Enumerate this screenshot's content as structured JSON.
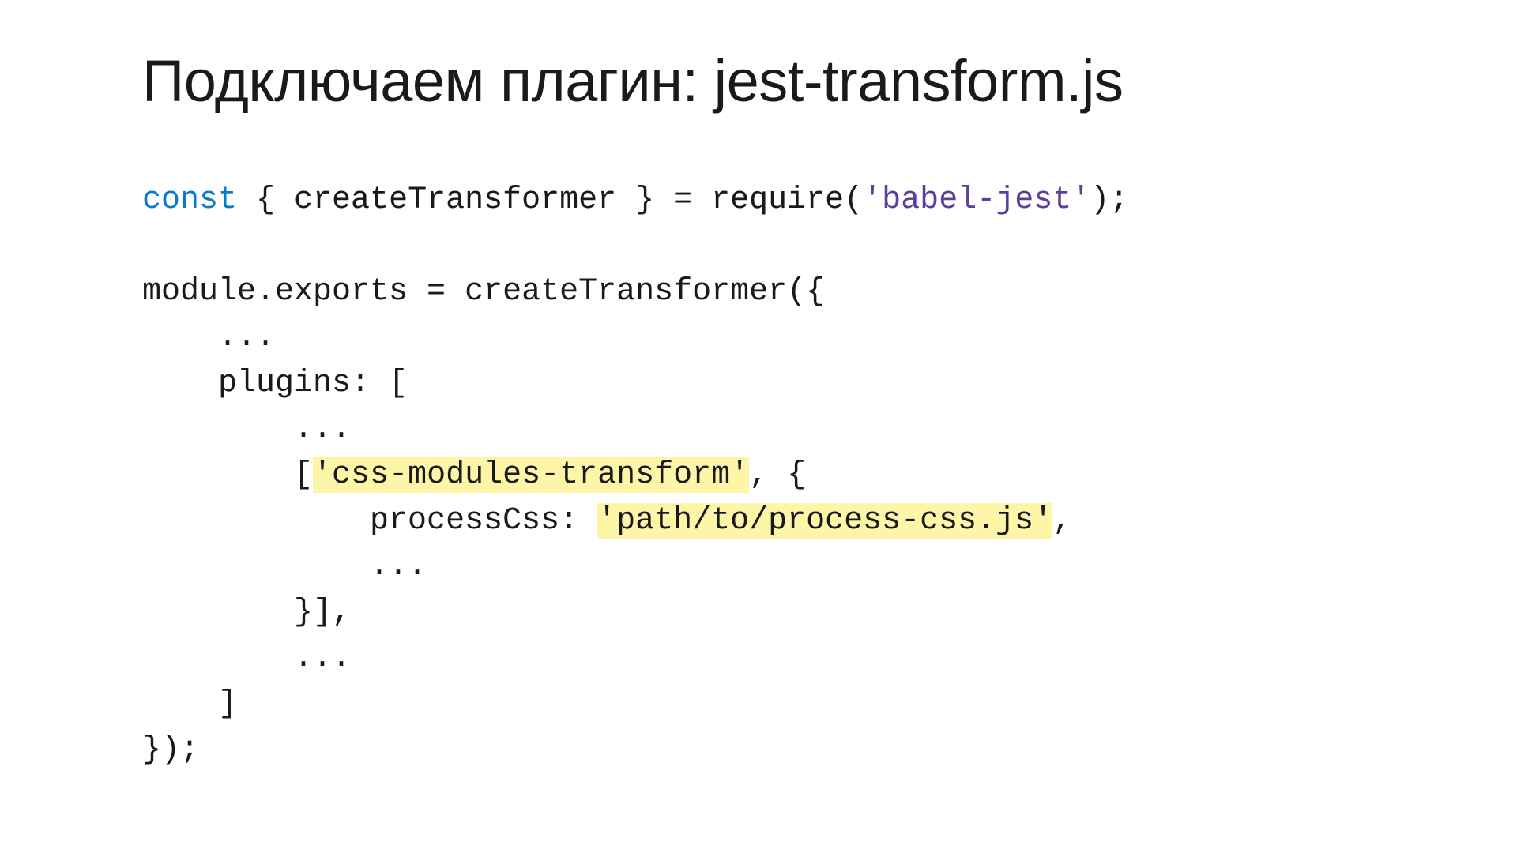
{
  "title": "Подключаем плагин: jest-transform.js",
  "code": {
    "l1_const": "const",
    "l1_rest": " { createTransformer } = require(",
    "l1_str": "'babel-jest'",
    "l1_end": ");",
    "l2": "",
    "l3": "module.exports = createTransformer({",
    "l4": "    ...",
    "l5": "    plugins: [",
    "l6": "        ...",
    "l7_pre": "        [",
    "l7_hl": "'css-modules-transform'",
    "l7_post": ", {",
    "l8_pre": "            processCss: ",
    "l8_hl": "'path/to/process-css.js'",
    "l8_post": ",",
    "l9": "            ...",
    "l10": "        }],",
    "l11": "        ...",
    "l12": "    ]",
    "l13": "});"
  }
}
